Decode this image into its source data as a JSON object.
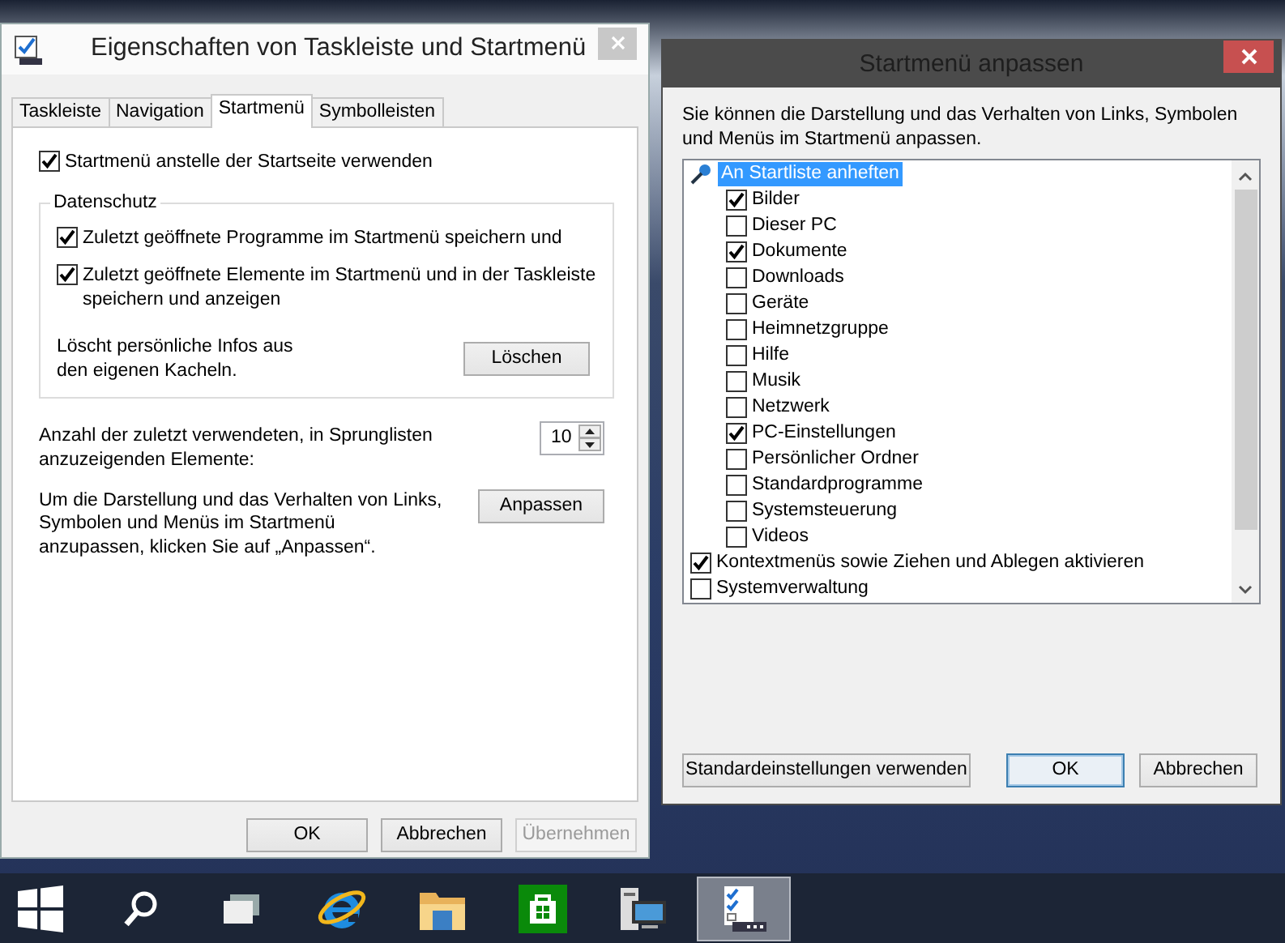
{
  "left_window": {
    "title": "Eigenschaften von Taskleiste und Startmenü",
    "tabs": [
      {
        "label": "Taskleiste",
        "selected": false
      },
      {
        "label": "Navigation",
        "selected": false
      },
      {
        "label": "Startmenü",
        "selected": true
      },
      {
        "label": "Symbolleisten",
        "selected": false
      }
    ],
    "start_menu_option": {
      "label": "Startmenü anstelle der Startseite verwenden",
      "checked": true
    },
    "privacy_group": {
      "title": "Datenschutz",
      "options": [
        {
          "label": "Zuletzt geöffnete Programme im Startmenü speichern und",
          "checked": true
        },
        {
          "label": "Zuletzt geöffnete Elemente im Startmenü und in der Taskleiste speichern und anzeigen",
          "checked": true
        }
      ],
      "clear_text": "Löscht persönliche Infos aus den eigenen Kacheln.",
      "clear_button": "Löschen"
    },
    "jump_list": {
      "label": "Anzahl der zuletzt verwendeten, in Sprunglisten anzuzeigenden Elemente:",
      "value": "10"
    },
    "customize": {
      "text": "Um die Darstellung und das Verhalten von Links, Symbolen und Menüs im Startmenü anzupassen, klicken Sie auf „Anpassen“.",
      "button": "Anpassen"
    },
    "buttons": [
      {
        "label": "OK",
        "disabled": false
      },
      {
        "label": "Abbrechen",
        "disabled": false
      },
      {
        "label": "Übernehmen",
        "disabled": true
      }
    ]
  },
  "right_window": {
    "title": "Startmenü anpassen",
    "description": "Sie können die Darstellung und das Verhalten von Links, Symbolen und Menüs im Startmenü anpassen.",
    "tree": [
      {
        "kind": "group",
        "label": "An Startliste anheften",
        "selected": true,
        "children": [
          {
            "kind": "checkbox",
            "label": "Bilder",
            "checked": true
          },
          {
            "kind": "checkbox",
            "label": "Dieser PC",
            "checked": false
          },
          {
            "kind": "checkbox",
            "label": "Dokumente",
            "checked": true
          },
          {
            "kind": "checkbox",
            "label": "Downloads",
            "checked": false
          },
          {
            "kind": "checkbox",
            "label": "Geräte",
            "checked": false
          },
          {
            "kind": "checkbox",
            "label": "Heimnetzgruppe",
            "checked": false
          },
          {
            "kind": "checkbox",
            "label": "Hilfe",
            "checked": false
          },
          {
            "kind": "checkbox",
            "label": "Musik",
            "checked": false
          },
          {
            "kind": "checkbox",
            "label": "Netzwerk",
            "checked": false
          },
          {
            "kind": "checkbox",
            "label": "PC-Einstellungen",
            "checked": true
          },
          {
            "kind": "checkbox",
            "label": "Persönlicher Ordner",
            "checked": false
          },
          {
            "kind": "checkbox",
            "label": "Standardprogramme",
            "checked": false
          },
          {
            "kind": "checkbox",
            "label": "Systemsteuerung",
            "checked": false
          },
          {
            "kind": "checkbox",
            "label": "Videos",
            "checked": false
          }
        ]
      },
      {
        "kind": "checkbox",
        "label": "Kontextmenüs sowie Ziehen und Ablegen aktivieren",
        "checked": true
      },
      {
        "kind": "checkbox",
        "label": "Systemverwaltung",
        "checked": false
      }
    ],
    "buttons": [
      {
        "label": "Standardeinstellungen verwenden",
        "default": false
      },
      {
        "label": "OK",
        "default": true
      },
      {
        "label": "Abbrechen",
        "default": false
      }
    ]
  },
  "taskbar": {
    "items": [
      {
        "kind": "start",
        "active": false
      },
      {
        "kind": "search",
        "active": false
      },
      {
        "kind": "task-view",
        "active": false
      },
      {
        "kind": "browser",
        "active": false
      },
      {
        "kind": "folder",
        "active": false
      },
      {
        "kind": "store",
        "active": false
      },
      {
        "kind": "network",
        "active": false
      },
      {
        "kind": "settings-dialog",
        "active": true
      }
    ]
  }
}
